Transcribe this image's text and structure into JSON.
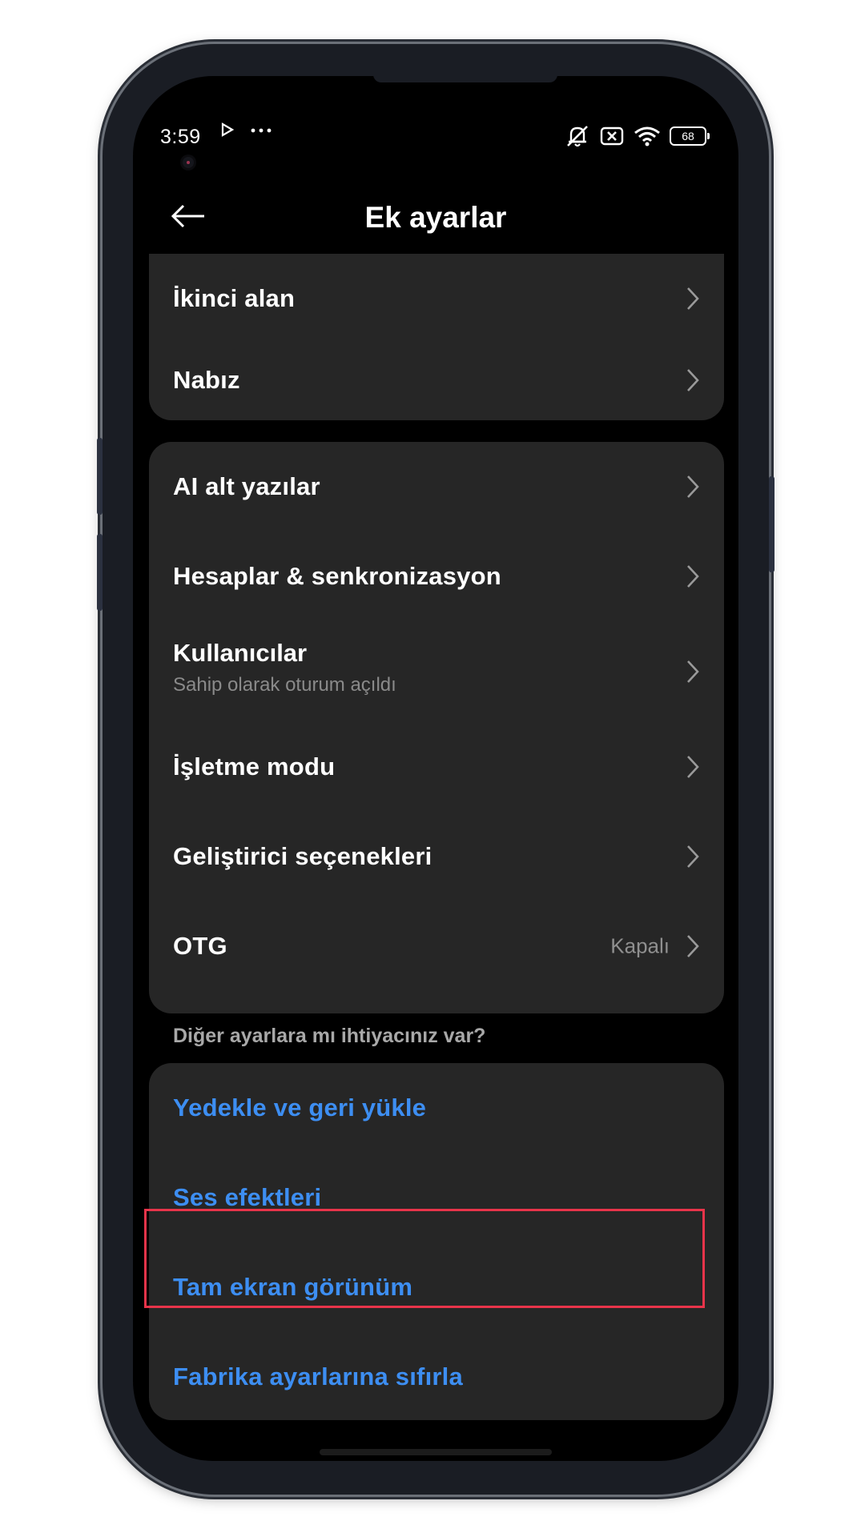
{
  "status_bar": {
    "time": "3:59",
    "left_icons": [
      "play-icon",
      "more-dots-icon"
    ],
    "right_icons": [
      "mute-icon",
      "close-box-icon",
      "wifi-icon"
    ],
    "battery": "68"
  },
  "header": {
    "back_icon": "arrow-left-icon",
    "title": "Ek ayarlar"
  },
  "group1": {
    "items": [
      {
        "label": "İkinci alan"
      },
      {
        "label": "Nabız"
      }
    ]
  },
  "group2": {
    "items": [
      {
        "label": "AI alt yazılar"
      },
      {
        "label": "Hesaplar & senkronizasyon"
      },
      {
        "label": "Kullanıcılar",
        "subtitle": "Sahip olarak oturum açıldı"
      },
      {
        "label": "İşletme modu"
      },
      {
        "label": "Geliştirici seçenekleri"
      },
      {
        "label": "OTG",
        "value": "Kapalı"
      }
    ]
  },
  "section_label": "Diğer ayarlara mı ihtiyacınız var?",
  "group3": {
    "link_color": "#3d8ef2",
    "items": [
      {
        "label": "Yedekle ve geri yükle"
      },
      {
        "label": "Ses efektleri"
      },
      {
        "label": "Tam ekran görünüm",
        "highlighted": true
      },
      {
        "label": "Fabrika ayarlarına sıfırla"
      }
    ]
  },
  "colors": {
    "background": "#000000",
    "card": "#262626",
    "accent_link": "#3d8ef2",
    "highlight": "#e8344a"
  }
}
